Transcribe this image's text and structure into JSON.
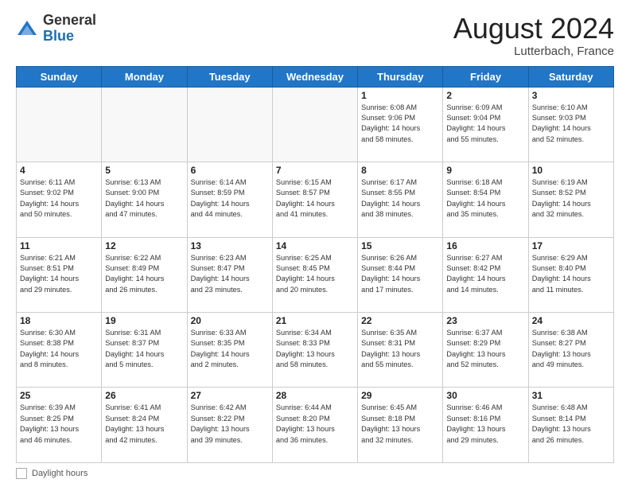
{
  "header": {
    "logo_general": "General",
    "logo_blue": "Blue",
    "month_year": "August 2024",
    "location": "Lutterbach, France"
  },
  "footer": {
    "daylight_label": "Daylight hours"
  },
  "weekdays": [
    "Sunday",
    "Monday",
    "Tuesday",
    "Wednesday",
    "Thursday",
    "Friday",
    "Saturday"
  ],
  "weeks": [
    [
      {
        "num": "",
        "info": ""
      },
      {
        "num": "",
        "info": ""
      },
      {
        "num": "",
        "info": ""
      },
      {
        "num": "",
        "info": ""
      },
      {
        "num": "1",
        "info": "Sunrise: 6:08 AM\nSunset: 9:06 PM\nDaylight: 14 hours\nand 58 minutes."
      },
      {
        "num": "2",
        "info": "Sunrise: 6:09 AM\nSunset: 9:04 PM\nDaylight: 14 hours\nand 55 minutes."
      },
      {
        "num": "3",
        "info": "Sunrise: 6:10 AM\nSunset: 9:03 PM\nDaylight: 14 hours\nand 52 minutes."
      }
    ],
    [
      {
        "num": "4",
        "info": "Sunrise: 6:11 AM\nSunset: 9:02 PM\nDaylight: 14 hours\nand 50 minutes."
      },
      {
        "num": "5",
        "info": "Sunrise: 6:13 AM\nSunset: 9:00 PM\nDaylight: 14 hours\nand 47 minutes."
      },
      {
        "num": "6",
        "info": "Sunrise: 6:14 AM\nSunset: 8:59 PM\nDaylight: 14 hours\nand 44 minutes."
      },
      {
        "num": "7",
        "info": "Sunrise: 6:15 AM\nSunset: 8:57 PM\nDaylight: 14 hours\nand 41 minutes."
      },
      {
        "num": "8",
        "info": "Sunrise: 6:17 AM\nSunset: 8:55 PM\nDaylight: 14 hours\nand 38 minutes."
      },
      {
        "num": "9",
        "info": "Sunrise: 6:18 AM\nSunset: 8:54 PM\nDaylight: 14 hours\nand 35 minutes."
      },
      {
        "num": "10",
        "info": "Sunrise: 6:19 AM\nSunset: 8:52 PM\nDaylight: 14 hours\nand 32 minutes."
      }
    ],
    [
      {
        "num": "11",
        "info": "Sunrise: 6:21 AM\nSunset: 8:51 PM\nDaylight: 14 hours\nand 29 minutes."
      },
      {
        "num": "12",
        "info": "Sunrise: 6:22 AM\nSunset: 8:49 PM\nDaylight: 14 hours\nand 26 minutes."
      },
      {
        "num": "13",
        "info": "Sunrise: 6:23 AM\nSunset: 8:47 PM\nDaylight: 14 hours\nand 23 minutes."
      },
      {
        "num": "14",
        "info": "Sunrise: 6:25 AM\nSunset: 8:45 PM\nDaylight: 14 hours\nand 20 minutes."
      },
      {
        "num": "15",
        "info": "Sunrise: 6:26 AM\nSunset: 8:44 PM\nDaylight: 14 hours\nand 17 minutes."
      },
      {
        "num": "16",
        "info": "Sunrise: 6:27 AM\nSunset: 8:42 PM\nDaylight: 14 hours\nand 14 minutes."
      },
      {
        "num": "17",
        "info": "Sunrise: 6:29 AM\nSunset: 8:40 PM\nDaylight: 14 hours\nand 11 minutes."
      }
    ],
    [
      {
        "num": "18",
        "info": "Sunrise: 6:30 AM\nSunset: 8:38 PM\nDaylight: 14 hours\nand 8 minutes."
      },
      {
        "num": "19",
        "info": "Sunrise: 6:31 AM\nSunset: 8:37 PM\nDaylight: 14 hours\nand 5 minutes."
      },
      {
        "num": "20",
        "info": "Sunrise: 6:33 AM\nSunset: 8:35 PM\nDaylight: 14 hours\nand 2 minutes."
      },
      {
        "num": "21",
        "info": "Sunrise: 6:34 AM\nSunset: 8:33 PM\nDaylight: 13 hours\nand 58 minutes."
      },
      {
        "num": "22",
        "info": "Sunrise: 6:35 AM\nSunset: 8:31 PM\nDaylight: 13 hours\nand 55 minutes."
      },
      {
        "num": "23",
        "info": "Sunrise: 6:37 AM\nSunset: 8:29 PM\nDaylight: 13 hours\nand 52 minutes."
      },
      {
        "num": "24",
        "info": "Sunrise: 6:38 AM\nSunset: 8:27 PM\nDaylight: 13 hours\nand 49 minutes."
      }
    ],
    [
      {
        "num": "25",
        "info": "Sunrise: 6:39 AM\nSunset: 8:25 PM\nDaylight: 13 hours\nand 46 minutes."
      },
      {
        "num": "26",
        "info": "Sunrise: 6:41 AM\nSunset: 8:24 PM\nDaylight: 13 hours\nand 42 minutes."
      },
      {
        "num": "27",
        "info": "Sunrise: 6:42 AM\nSunset: 8:22 PM\nDaylight: 13 hours\nand 39 minutes."
      },
      {
        "num": "28",
        "info": "Sunrise: 6:44 AM\nSunset: 8:20 PM\nDaylight: 13 hours\nand 36 minutes."
      },
      {
        "num": "29",
        "info": "Sunrise: 6:45 AM\nSunset: 8:18 PM\nDaylight: 13 hours\nand 32 minutes."
      },
      {
        "num": "30",
        "info": "Sunrise: 6:46 AM\nSunset: 8:16 PM\nDaylight: 13 hours\nand 29 minutes."
      },
      {
        "num": "31",
        "info": "Sunrise: 6:48 AM\nSunset: 8:14 PM\nDaylight: 13 hours\nand 26 minutes."
      }
    ]
  ]
}
